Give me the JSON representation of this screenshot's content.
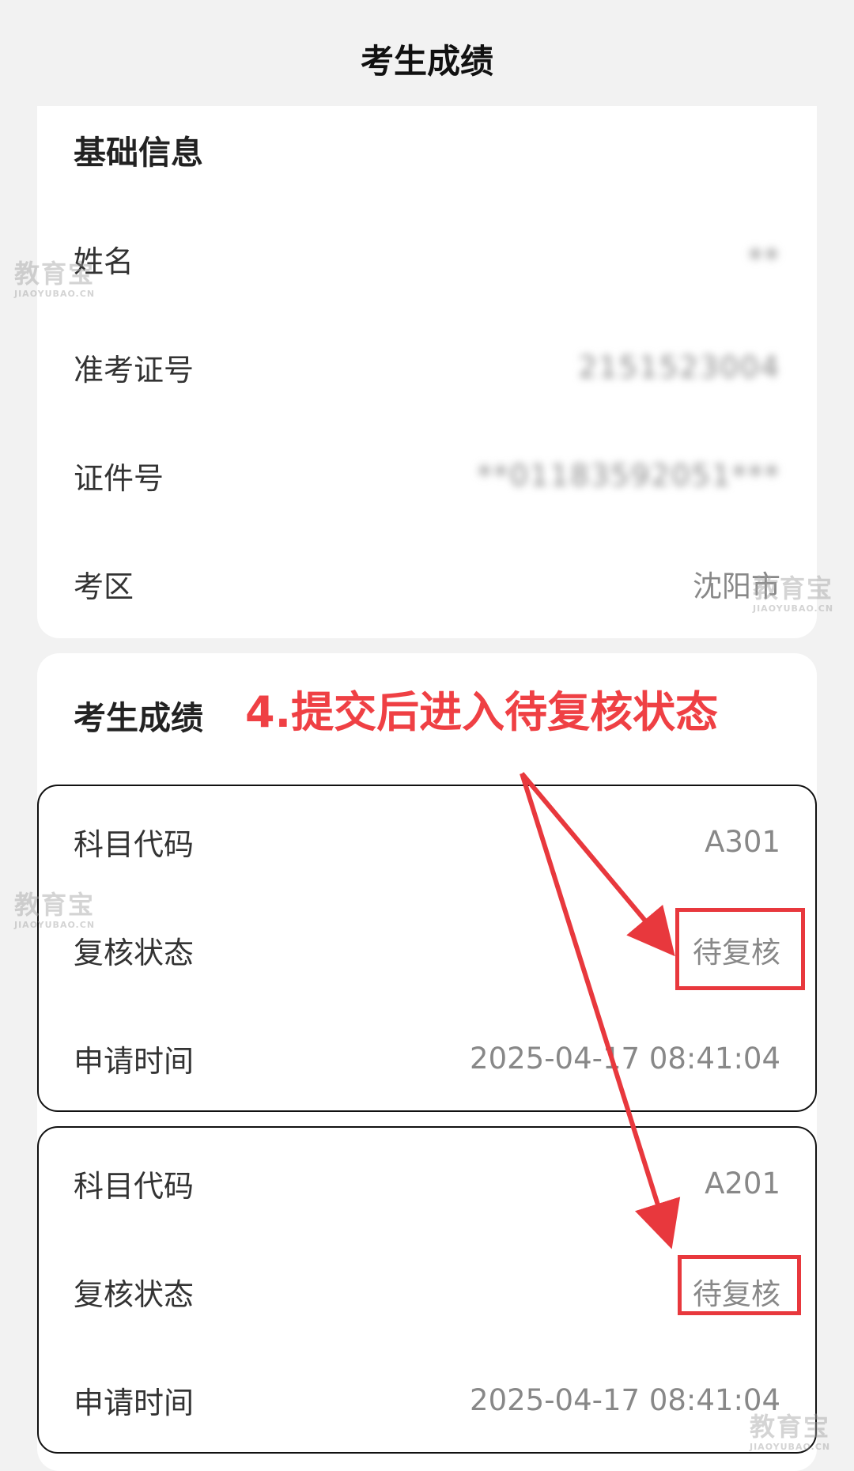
{
  "header": {
    "title": "考生成绩"
  },
  "basic_info": {
    "title": "基础信息",
    "rows": [
      {
        "label": "姓名",
        "value": "**"
      },
      {
        "label": "准考证号",
        "value": "2151523004"
      },
      {
        "label": "证件号",
        "value": "**01183592051***"
      },
      {
        "label": "考区",
        "value": "沈阳市"
      }
    ]
  },
  "scores": {
    "title": "考生成绩",
    "items": [
      {
        "code_label": "科目代码",
        "code": "A301",
        "status_label": "复核状态",
        "status": "待复核",
        "time_label": "申请时间",
        "time": "2025-04-17 08:41:04"
      },
      {
        "code_label": "科目代码",
        "code": "A201",
        "status_label": "复核状态",
        "status": "待复核",
        "time_label": "申请时间",
        "time": "2025-04-17 08:41:04"
      }
    ]
  },
  "annotation": {
    "text": "4.提交后进入待复核状态",
    "color": "#ef4044"
  },
  "watermark": {
    "main": "教育宝",
    "sub": "JIAOYUBAO.CN"
  }
}
